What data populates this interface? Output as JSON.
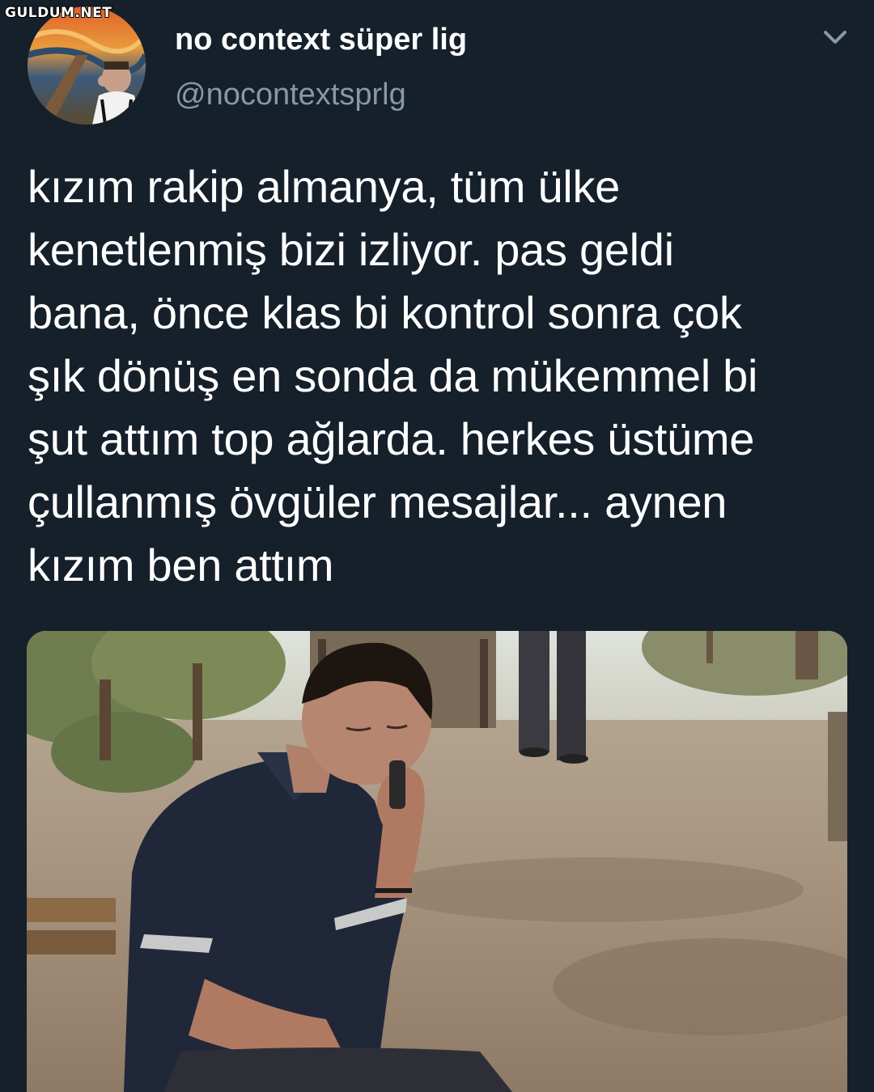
{
  "watermark": "GULDUM.NET",
  "tweet": {
    "display_name": "no context süper lig",
    "handle": "@nocontextsprlg",
    "avatar_icon": "profile-avatar",
    "menu_icon": "chevron-down-icon",
    "text_lines": [
      "kızım rakip almanya, tüm ülke",
      "kenetlenmiş bizi izliyor. pas geldi",
      "bana, önce klas bi kontrol sonra çok",
      "şık dönüş en sonda da mükemmel bi",
      "şut attım top ağlarda. herkes üstüme",
      "çullanmış övgüler mesajlar... aynen",
      "kızım ben attım"
    ]
  },
  "colors": {
    "background": "#15202b",
    "text": "#ffffff",
    "secondary_text": "#8899a6"
  }
}
